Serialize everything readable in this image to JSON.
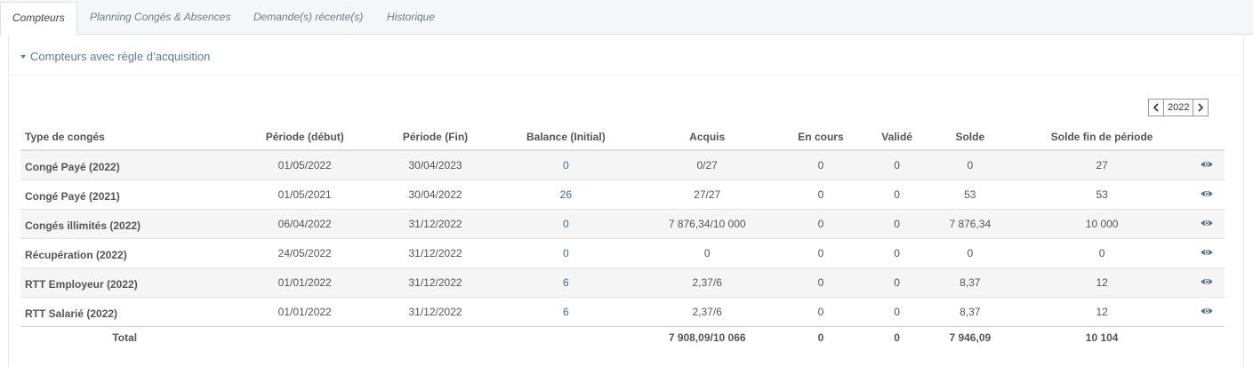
{
  "tabs": [
    {
      "label": "Compteurs",
      "active": true
    },
    {
      "label": "Planning Congés & Absences",
      "active": false
    },
    {
      "label": "Demande(s) récente(s)",
      "active": false
    },
    {
      "label": "Historique",
      "active": false
    }
  ],
  "section": {
    "title": "Compteurs avec règle d’acquisition"
  },
  "year_picker": {
    "value": "2022",
    "prev_icon": "chevron-left-icon",
    "next_icon": "chevron-right-icon"
  },
  "table": {
    "headers": [
      "Type de congés",
      "Période (début)",
      "Période (Fin)",
      "Balance (Initial)",
      "Acquis",
      "En cours",
      "Validé",
      "Solde",
      "Solde fin de période"
    ],
    "rows": [
      {
        "type": "Congé Payé (2022)",
        "start": "01/05/2022",
        "end": "30/04/2023",
        "balance": "0",
        "acquis": "0/27",
        "en_cours": "0",
        "valide": "0",
        "solde": "0",
        "solde_fin": "27"
      },
      {
        "type": "Congé Payé (2021)",
        "start": "01/05/2021",
        "end": "30/04/2022",
        "balance": "26",
        "acquis": "27/27",
        "en_cours": "0",
        "valide": "0",
        "solde": "53",
        "solde_fin": "53"
      },
      {
        "type": "Congés illimités (2022)",
        "start": "06/04/2022",
        "end": "31/12/2022",
        "balance": "0",
        "acquis": "7 876,34/10 000",
        "en_cours": "0",
        "valide": "0",
        "solde": "7 876,34",
        "solde_fin": "10 000"
      },
      {
        "type": "Récupération (2022)",
        "start": "24/05/2022",
        "end": "31/12/2022",
        "balance": "0",
        "acquis": "0",
        "en_cours": "0",
        "valide": "0",
        "solde": "0",
        "solde_fin": "0"
      },
      {
        "type": "RTT Employeur (2022)",
        "start": "01/01/2022",
        "end": "31/12/2022",
        "balance": "6",
        "acquis": "2,37/6",
        "en_cours": "0",
        "valide": "0",
        "solde": "8,37",
        "solde_fin": "12"
      },
      {
        "type": "RTT Salarié (2022)",
        "start": "01/01/2022",
        "end": "31/12/2022",
        "balance": "6",
        "acquis": "2,37/6",
        "en_cours": "0",
        "valide": "0",
        "solde": "8,37",
        "solde_fin": "12"
      }
    ],
    "total": {
      "label": "Total",
      "acquis": "7 908,09/10 066",
      "en_cours": "0",
      "valide": "0",
      "solde": "7 946,09",
      "solde_fin": "10 104"
    },
    "row_action_icon": "eye-icon"
  },
  "colors": {
    "link": "#3a6ea5",
    "header_text": "#5a7a99",
    "icon": "#5f7384"
  }
}
